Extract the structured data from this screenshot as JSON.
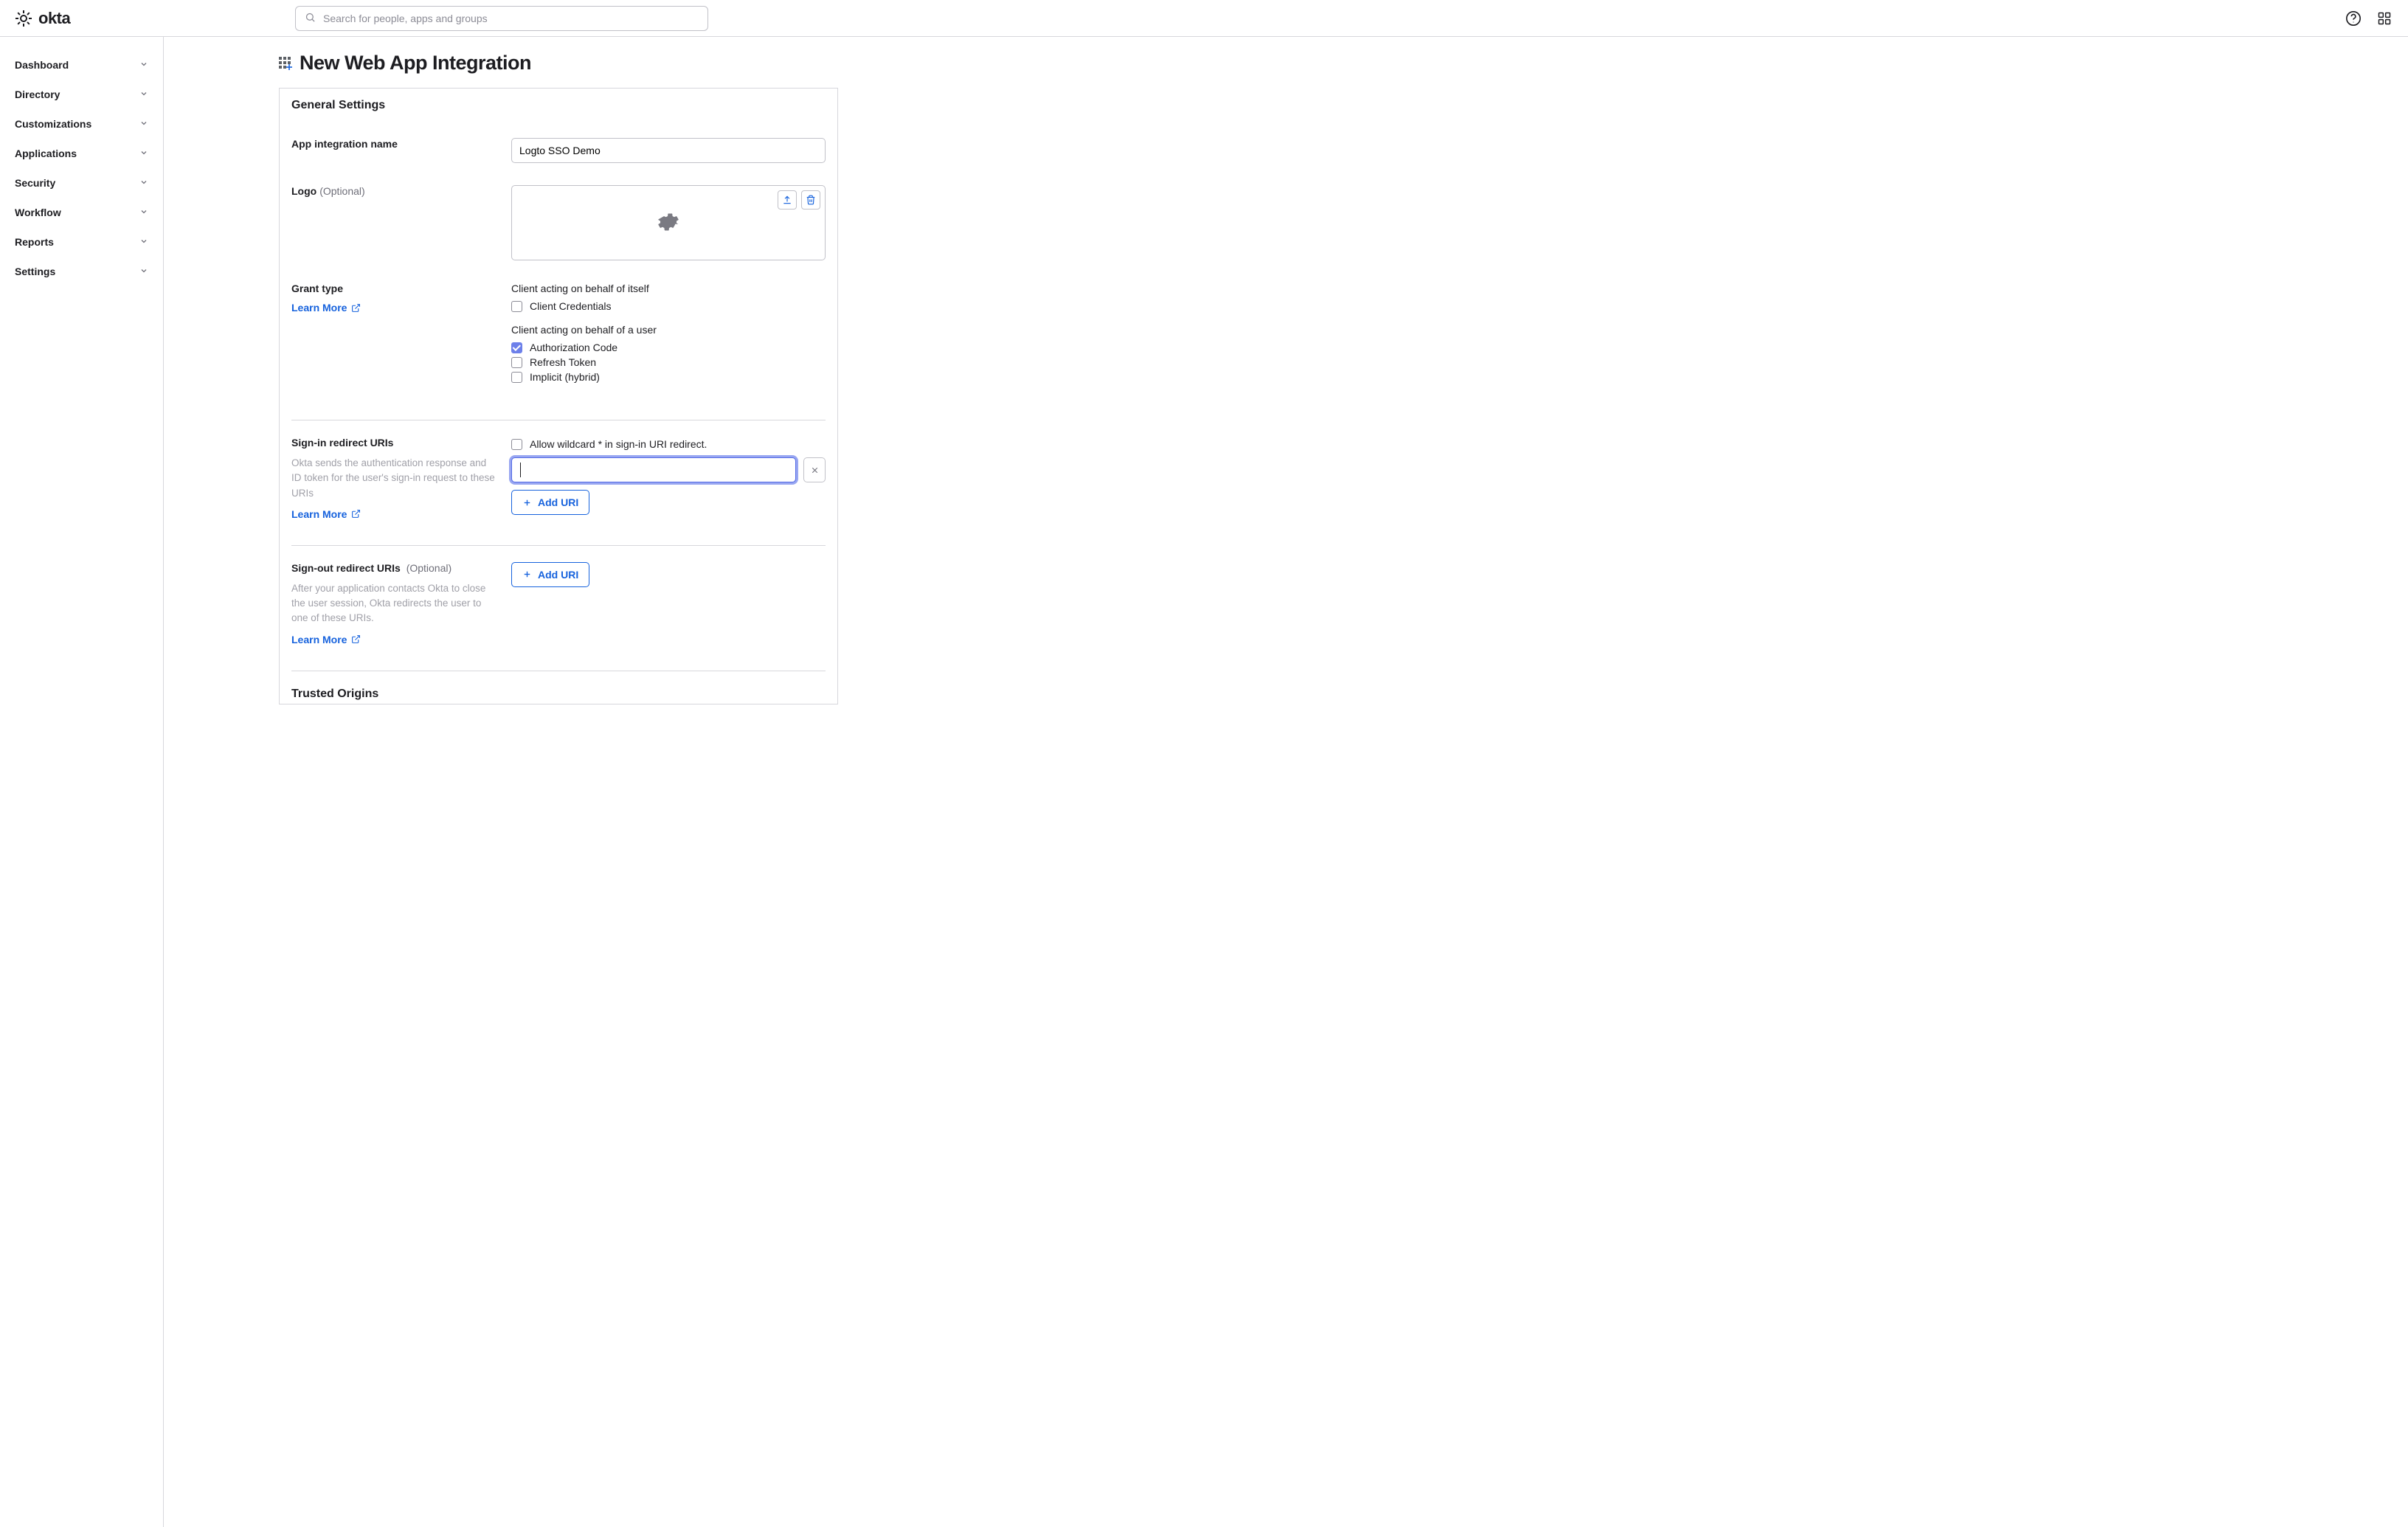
{
  "header": {
    "logo_text": "okta",
    "search_placeholder": "Search for people, apps and groups"
  },
  "sidebar": {
    "items": [
      {
        "label": "Dashboard"
      },
      {
        "label": "Directory"
      },
      {
        "label": "Customizations"
      },
      {
        "label": "Applications"
      },
      {
        "label": "Security"
      },
      {
        "label": "Workflow"
      },
      {
        "label": "Reports"
      },
      {
        "label": "Settings"
      }
    ]
  },
  "main": {
    "page_title": "New Web App Integration",
    "card_header": "General Settings",
    "fields": {
      "app_name": {
        "label": "App integration name",
        "value": "Logto SSO Demo"
      },
      "logo": {
        "label": "Logo",
        "optional": "(Optional)"
      },
      "grant_type": {
        "label": "Grant type",
        "learn_more": "Learn More",
        "group1_title": "Client acting on behalf of itself",
        "group1_options": [
          {
            "label": "Client Credentials",
            "checked": false
          }
        ],
        "group2_title": "Client acting on behalf of a user",
        "group2_options": [
          {
            "label": "Authorization Code",
            "checked": true
          },
          {
            "label": "Refresh Token",
            "checked": false
          },
          {
            "label": "Implicit (hybrid)",
            "checked": false
          }
        ]
      },
      "signin_redirect": {
        "label": "Sign-in redirect URIs",
        "help": "Okta sends the authentication response and ID token for the user's sign-in request to these URIs",
        "learn_more": "Learn More",
        "allow_wildcard_label": "Allow wildcard * in sign-in URI redirect.",
        "uri_value": "",
        "add_uri_label": "Add URI"
      },
      "signout_redirect": {
        "label": "Sign-out redirect URIs",
        "optional": "(Optional)",
        "help": "After your application contacts Okta to close the user session, Okta redirects the user to one of these URIs.",
        "learn_more": "Learn More",
        "add_uri_label": "Add URI"
      },
      "trusted_origins": {
        "label": "Trusted Origins"
      }
    }
  }
}
